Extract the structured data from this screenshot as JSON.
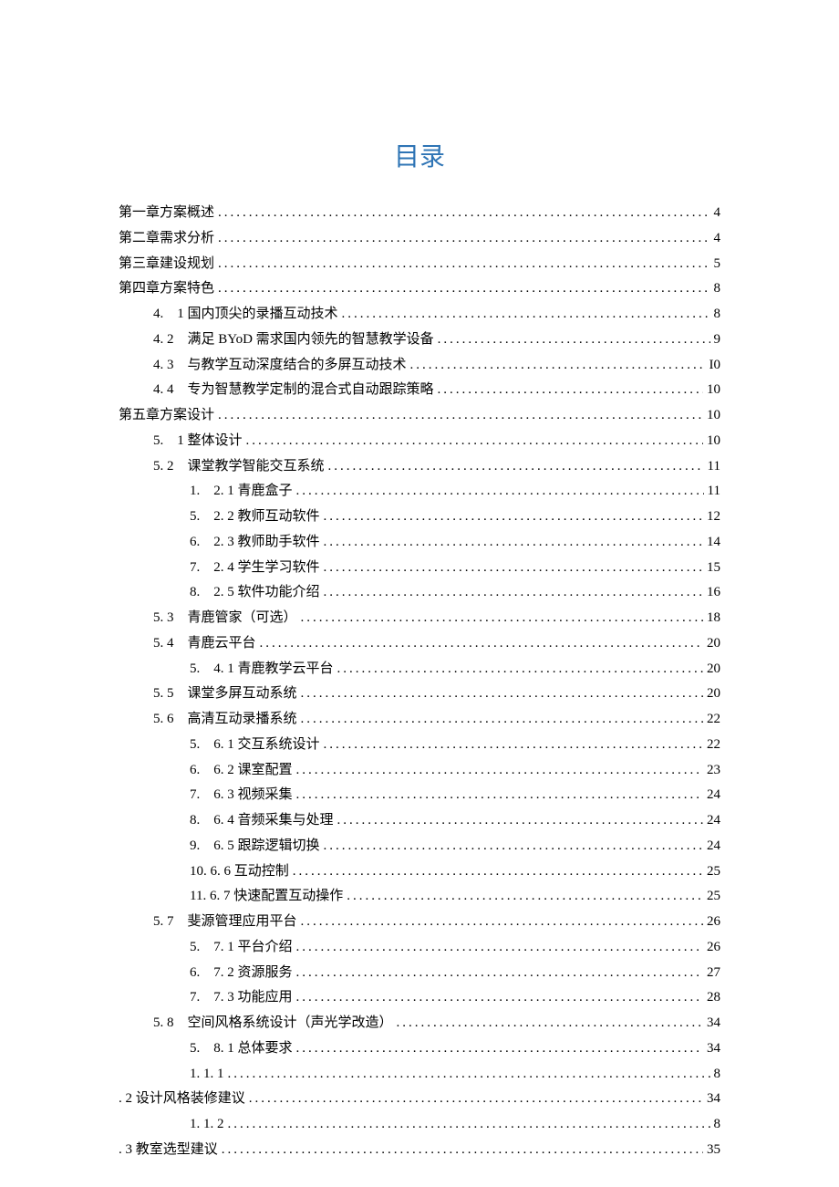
{
  "title": "目录",
  "entries": [
    {
      "level": 0,
      "label": "第一章方案概述",
      "page": "4"
    },
    {
      "level": 0,
      "label": "第二章需求分析",
      "page": "4"
    },
    {
      "level": 0,
      "label": "第三章建设规划",
      "page": "5"
    },
    {
      "level": 0,
      "label": "第四章方案特色",
      "page": "8"
    },
    {
      "level": 1,
      "label": "4.　1 国内顶尖的录播互动技术",
      "page": "8"
    },
    {
      "level": 1,
      "label": "4. 2　满足 BYoD 需求国内领先的智慧教学设备",
      "page": "9"
    },
    {
      "level": 1,
      "label": "4. 3　与教学互动深度结合的多屏互动技术",
      "page": "I0"
    },
    {
      "level": 1,
      "label": "4. 4　专为智慧教学定制的混合式自动跟踪策略",
      "page": "10"
    },
    {
      "level": 0,
      "label": "第五章方案设计",
      "page": "10"
    },
    {
      "level": 1,
      "label": "5.　1 整体设计",
      "page": "10"
    },
    {
      "level": 1,
      "label": "5. 2　课堂教学智能交互系统",
      "page": "11"
    },
    {
      "level": 2,
      "label": "1.　2. 1 青鹿盒子",
      "page": "11"
    },
    {
      "level": 2,
      "label": "5.　2. 2 教师互动软件",
      "page": "12"
    },
    {
      "level": 2,
      "label": "6.　2. 3 教师助手软件",
      "page": "14"
    },
    {
      "level": 2,
      "label": "7.　2. 4 学生学习软件",
      "page": "15"
    },
    {
      "level": 2,
      "label": "8.　2. 5 软件功能介绍",
      "page": "16"
    },
    {
      "level": 1,
      "label": "5. 3　青鹿管家（可选）",
      "page": "18"
    },
    {
      "level": 1,
      "label": "5. 4　青鹿云平台",
      "page": "20"
    },
    {
      "level": 2,
      "label": "5.　4. 1 青鹿教学云平台",
      "page": "20"
    },
    {
      "level": 1,
      "label": "5. 5　课堂多屏互动系统",
      "page": "20"
    },
    {
      "level": 1,
      "label": "5. 6　高清互动录播系统",
      "page": "22"
    },
    {
      "level": 2,
      "label": "5.　6. 1 交互系统设计",
      "page": "22"
    },
    {
      "level": 2,
      "label": "6.　6. 2 课室配置",
      "page": "23"
    },
    {
      "level": 2,
      "label": "7.　6. 3 视频采集",
      "page": "24"
    },
    {
      "level": 2,
      "label": "8.　6. 4 音频采集与处理",
      "page": "24"
    },
    {
      "level": 2,
      "label": "9.　6. 5 跟踪逻辑切换",
      "page": "24"
    },
    {
      "level": 2,
      "label": "10. 6. 6 互动控制",
      "page": "25"
    },
    {
      "level": 2,
      "label": "11. 6. 7 快速配置互动操作",
      "page": "25"
    },
    {
      "level": 1,
      "label": "5. 7　斐源管理应用平台",
      "page": "26"
    },
    {
      "level": 2,
      "label": "5.　7. 1 平台介绍",
      "page": "26"
    },
    {
      "level": 2,
      "label": "6.　7. 2 资源服务",
      "page": "27"
    },
    {
      "level": 2,
      "label": "7.　7. 3 功能应用",
      "page": "28"
    },
    {
      "level": 1,
      "label": "5. 8　空间风格系统设计（声光学改造）",
      "page": "34"
    },
    {
      "level": 2,
      "label": "5.　8. 1 总体要求",
      "page": "34"
    },
    {
      "level": 2,
      "label": "1. 1. 1",
      "page": "8"
    },
    {
      "level": 0,
      "label": ". 2 设计风格装修建议",
      "page": "34"
    },
    {
      "level": 2,
      "label": "1. 1. 2",
      "page": "8"
    },
    {
      "level": 0,
      "label": ". 3 教室选型建议",
      "page": "35"
    }
  ]
}
